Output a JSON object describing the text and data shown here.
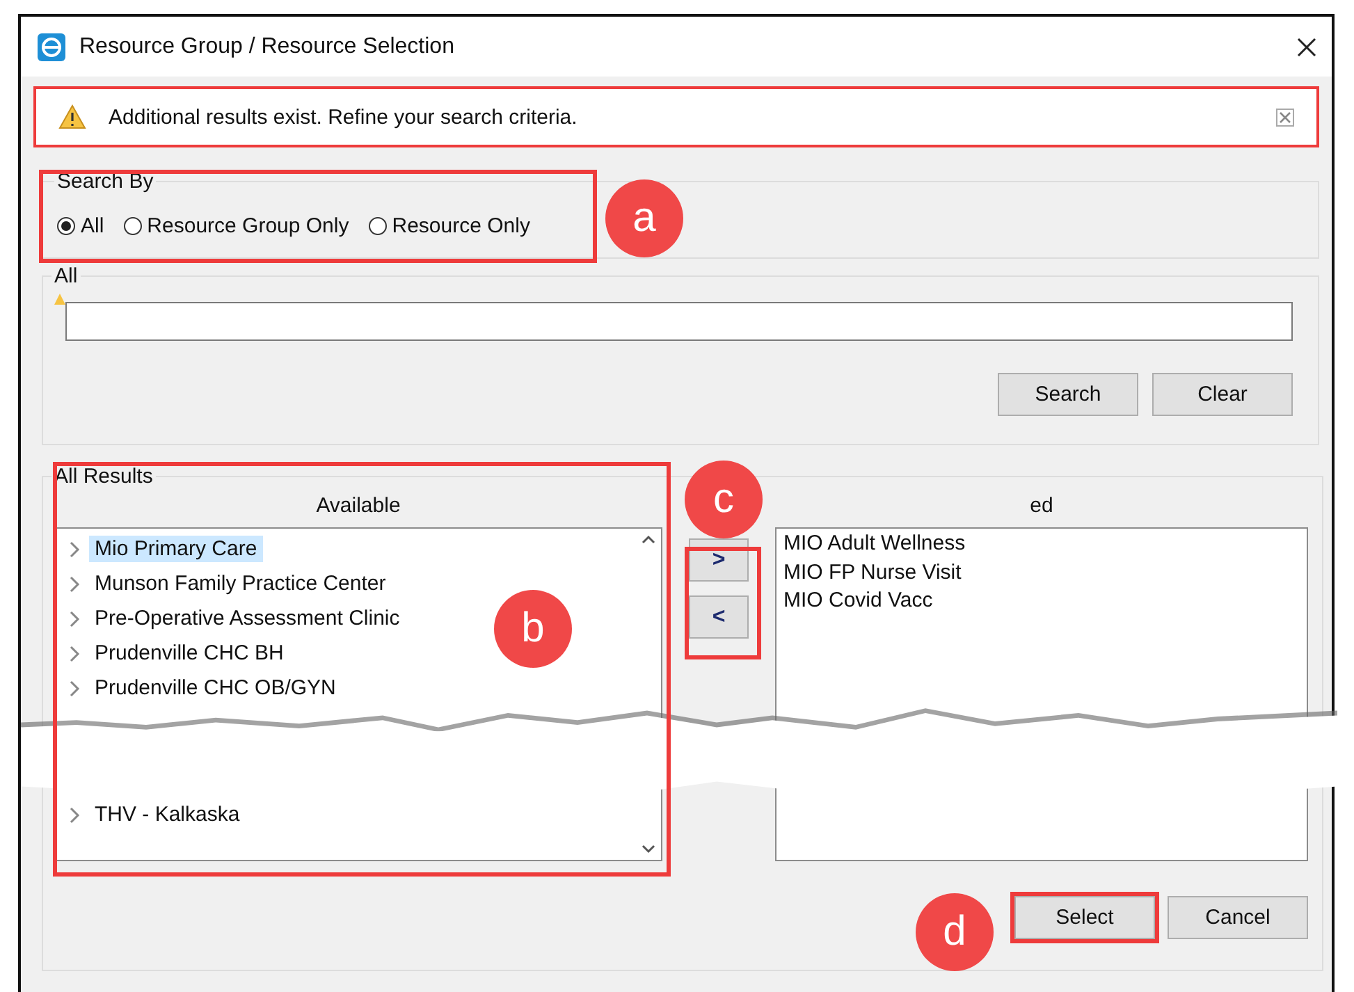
{
  "window": {
    "title": "Resource Group / Resource Selection"
  },
  "message_bar": {
    "text": "Additional results exist.  Refine your search criteria.",
    "highlighted": true
  },
  "search_by": {
    "legend": "Search By",
    "highlighted": true,
    "options": [
      {
        "label": "All",
        "selected": true
      },
      {
        "label": "Resource Group Only",
        "selected": false
      },
      {
        "label": "Resource Only",
        "selected": false
      }
    ]
  },
  "all_group": {
    "legend": "All",
    "buttons": [
      "Search",
      "Clear"
    ]
  },
  "results": {
    "legend": "All Results",
    "highlighted": true,
    "available": {
      "header": "Available",
      "items_top": [
        {
          "label": "Mio Primary Care",
          "selected": true
        },
        {
          "label": "Munson Family Practice Center",
          "selected": false
        },
        {
          "label": "Pre-Operative Assessment Clinic",
          "selected": false
        },
        {
          "label": "Prudenville CHC BH",
          "selected": false
        },
        {
          "label": "Prudenville CHC OB/GYN",
          "selected": false
        }
      ],
      "items_bottom": [
        {
          "label": "THV - Kalkaska",
          "selected": false
        }
      ]
    },
    "move_buttons": {
      "highlighted": true,
      "buttons": [
        ">",
        "<"
      ]
    },
    "selected_list": {
      "header": "ed",
      "items": [
        "MIO Adult Wellness",
        "MIO FP Nurse Visit",
        "MIO Covid Vacc"
      ]
    }
  },
  "footer_buttons": [
    {
      "label": "Select",
      "highlighted": true
    },
    {
      "label": "Cancel",
      "highlighted": false
    }
  ],
  "callouts": [
    "a",
    "b",
    "c",
    "d"
  ]
}
